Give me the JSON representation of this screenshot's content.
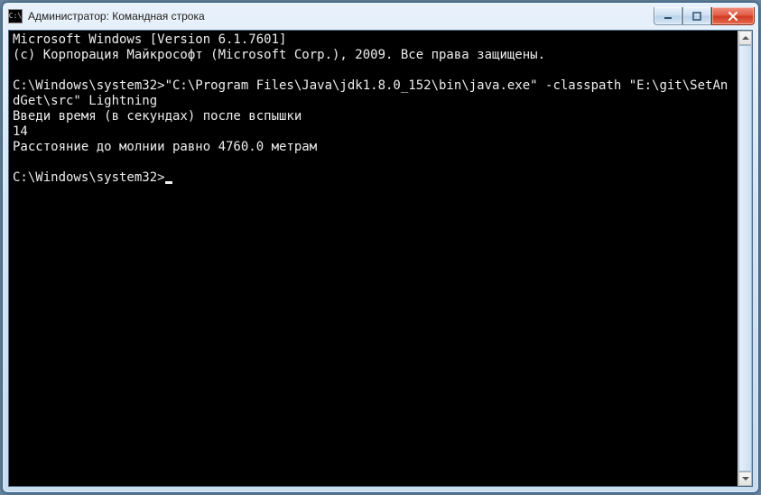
{
  "window": {
    "title": "Администратор: Командная строка",
    "icon_glyph": "C:\\"
  },
  "terminal": {
    "lines": [
      "Microsoft Windows [Version 6.1.7601]",
      "(c) Корпорация Майкрософт (Microsoft Corp.), 2009. Все права защищены.",
      "",
      "C:\\Windows\\system32>\"C:\\Program Files\\Java\\jdk1.8.0_152\\bin\\java.exe\" -classpath \"E:\\git\\SetAndGet\\src\" Lightning",
      "Введи время (в секундах) после вспышки",
      "14",
      "Расстояние до молнии равно 4760.0 метрам",
      ""
    ],
    "prompt": "C:\\Windows\\system32>"
  }
}
